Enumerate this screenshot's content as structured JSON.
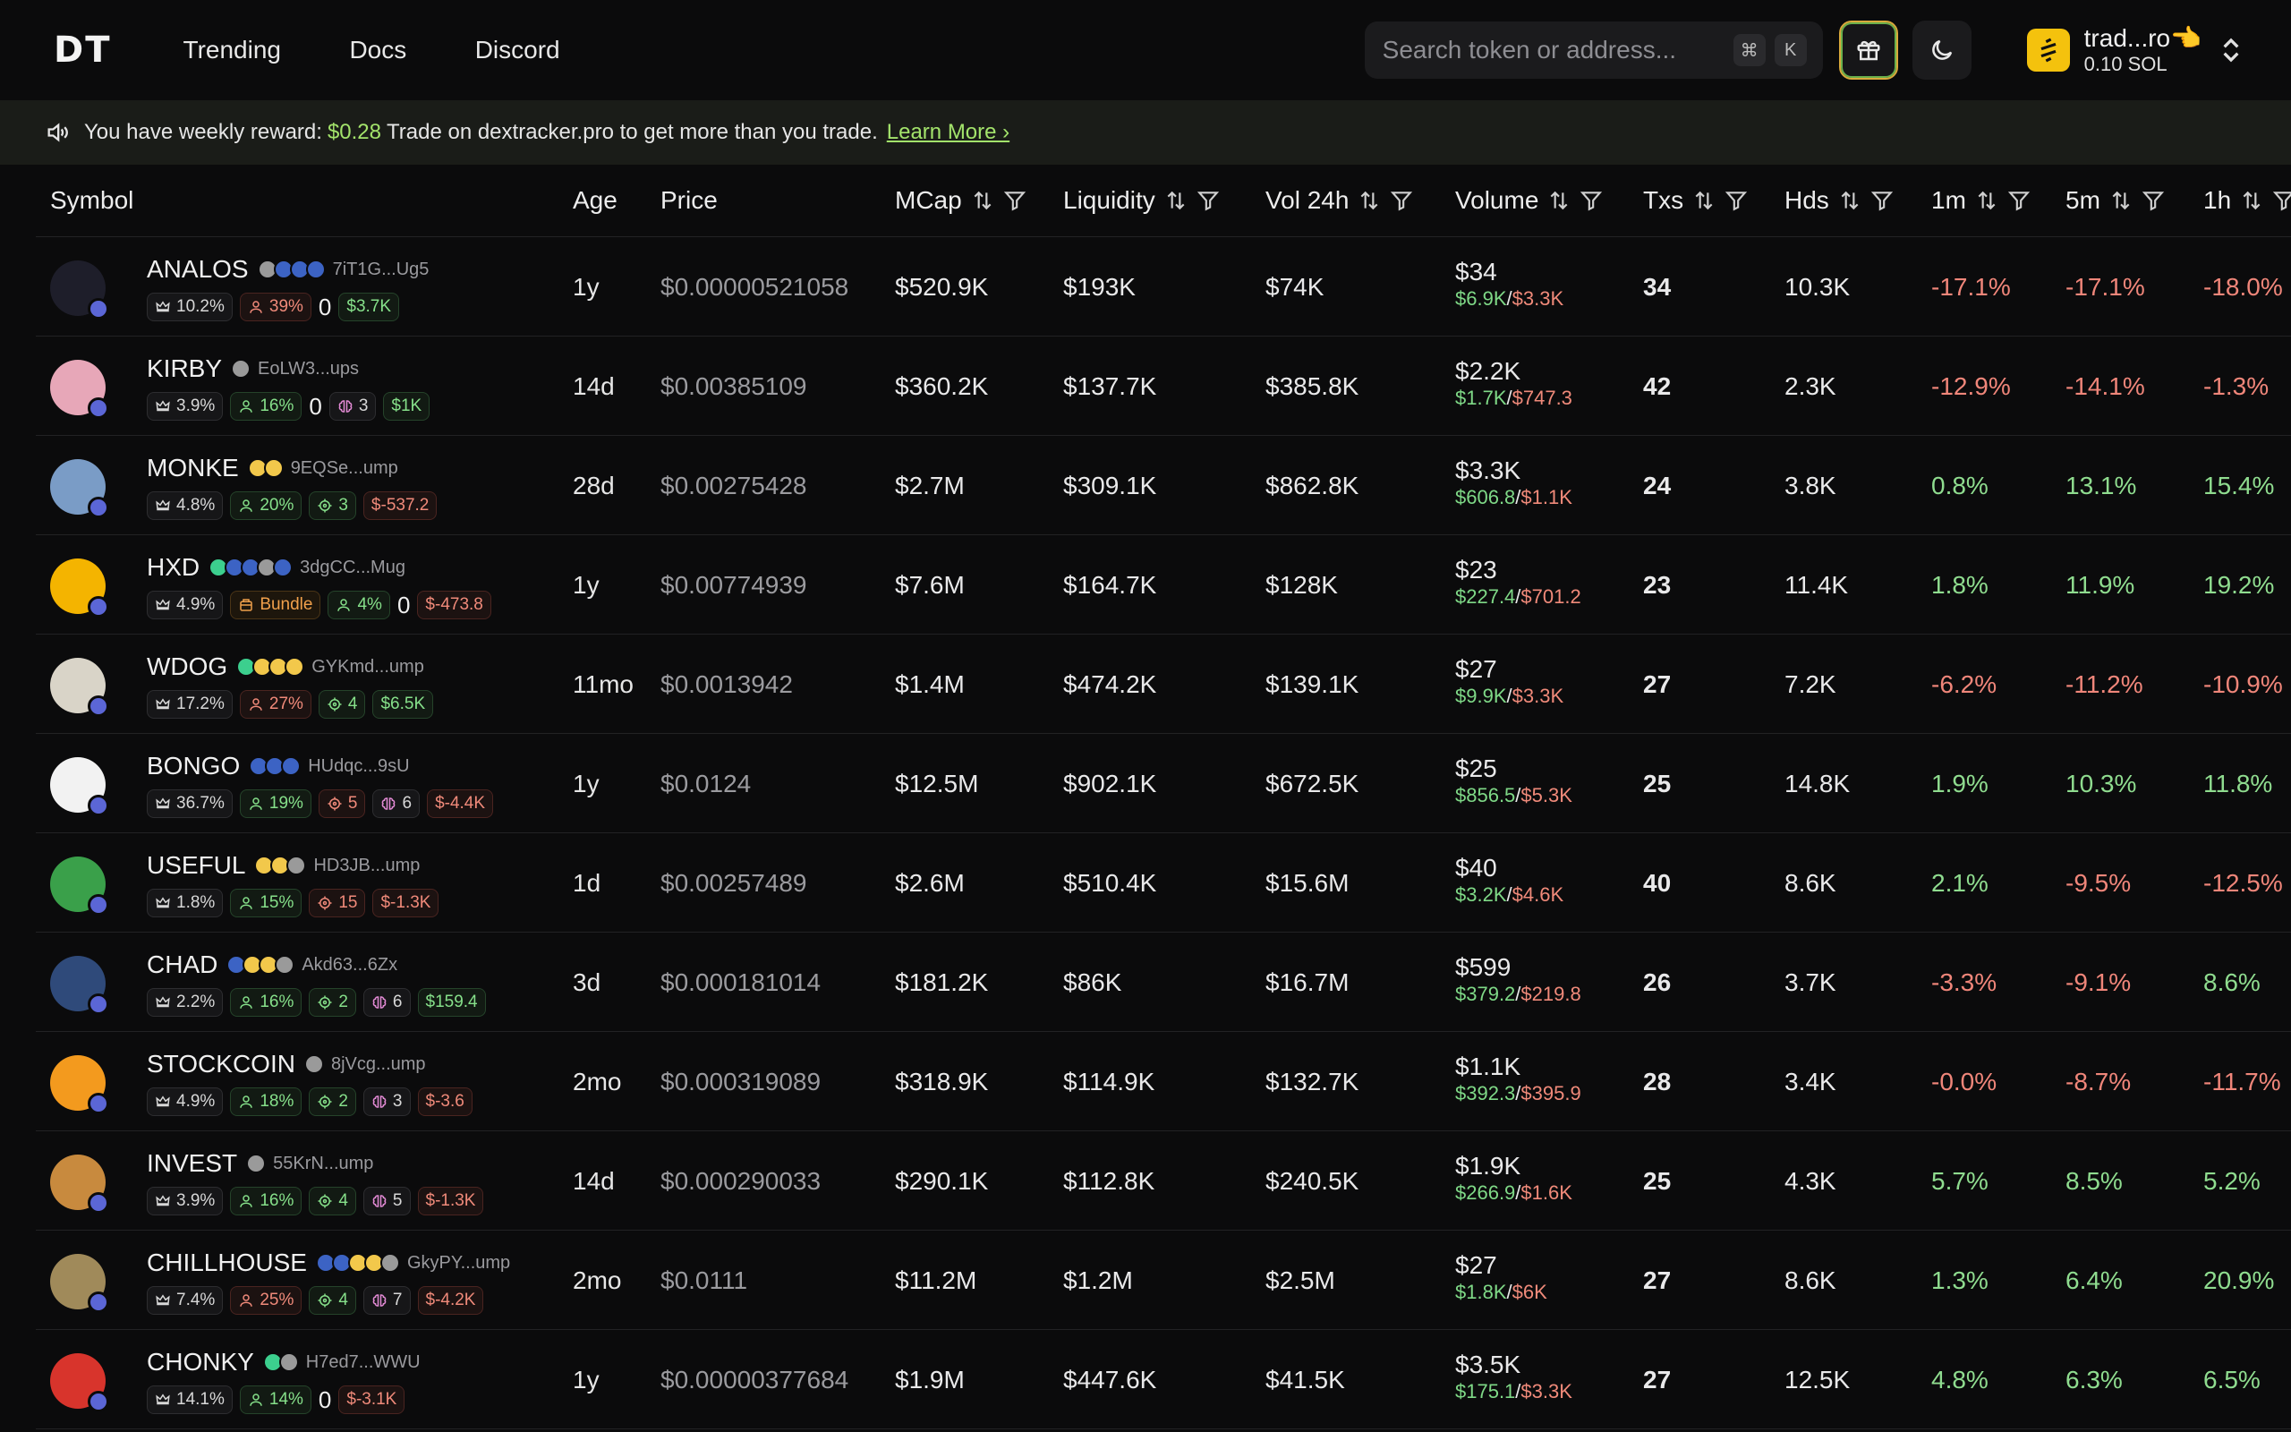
{
  "header": {
    "logo": "DT",
    "nav": [
      "Trending",
      "Docs",
      "Discord"
    ],
    "search_placeholder": "Search token or address...",
    "kbd": [
      "⌘",
      "K"
    ],
    "wallet_name": "trad...ro👈",
    "wallet_balance": "0.10 SOL"
  },
  "banner": {
    "prefix": "You have weekly reward:",
    "amount": "$0.28",
    "message": "Trade on dextracker.pro to get more than you trade.",
    "learn_more": "Learn More ›"
  },
  "columns": [
    "Symbol",
    "Age",
    "Price",
    "MCap",
    "Liquidity",
    "Vol 24h",
    "Volume",
    "Txs",
    "Hds",
    "1m",
    "5m",
    "1h"
  ],
  "rows": [
    {
      "symbol": "ANALOS",
      "addr": "7iT1G...Ug5",
      "avatar_color": "#1e1e2a",
      "socials": [
        "#9a9a9a",
        "#3c63c4",
        "#3c63c4",
        "#3c63c4"
      ],
      "badges": [
        {
          "icon": "crown-icon",
          "text": "10.2%",
          "style": "plain"
        },
        {
          "icon": "user-icon",
          "text": "39%",
          "style": "red"
        },
        {
          "type": "zero",
          "text": "0"
        },
        {
          "text": "$3.7K",
          "style": "green"
        }
      ],
      "age": "1y",
      "price": "$0.00000521058",
      "mcap": "$520.9K",
      "liquidity": "$193K",
      "vol24h": "$74K",
      "volume": "$34",
      "buy": "$6.9K",
      "sell": "$3.3K",
      "txs": "34",
      "hds": "10.3K",
      "m1": "-17.1%",
      "m5": "-17.1%",
      "h1": "-18.0%"
    },
    {
      "symbol": "KIRBY",
      "addr": "EoLW3...ups",
      "avatar_color": "#e7a7b8",
      "socials": [
        "#9a9a9a"
      ],
      "badges": [
        {
          "icon": "crown-icon",
          "text": "3.9%",
          "style": "plain"
        },
        {
          "icon": "user-icon",
          "text": "16%",
          "style": "green"
        },
        {
          "type": "zero",
          "text": "0"
        },
        {
          "icon": "brain-icon",
          "text": "3",
          "style": "plain"
        },
        {
          "text": "$1K",
          "style": "green"
        }
      ],
      "age": "14d",
      "price": "$0.00385109",
      "mcap": "$360.2K",
      "liquidity": "$137.7K",
      "vol24h": "$385.8K",
      "volume": "$2.2K",
      "buy": "$1.7K",
      "sell": "$747.3",
      "txs": "42",
      "hds": "2.3K",
      "m1": "-12.9%",
      "m5": "-14.1%",
      "h1": "-1.3%"
    },
    {
      "symbol": "MONKE",
      "addr": "9EQSe...ump",
      "avatar_color": "#7a9cc6",
      "socials": [
        "#f2c84b",
        "#f2c84b"
      ],
      "badges": [
        {
          "icon": "crown-icon",
          "text": "4.8%",
          "style": "plain"
        },
        {
          "icon": "user-icon",
          "text": "20%",
          "style": "green"
        },
        {
          "icon": "target-icon",
          "text": "3",
          "style": "green"
        },
        {
          "text": "$-537.2",
          "style": "red"
        }
      ],
      "age": "28d",
      "price": "$0.00275428",
      "mcap": "$2.7M",
      "liquidity": "$309.1K",
      "vol24h": "$862.8K",
      "volume": "$3.3K",
      "buy": "$606.8",
      "sell": "$1.1K",
      "txs": "24",
      "hds": "3.8K",
      "m1": "0.8%",
      "m5": "13.1%",
      "h1": "15.4%"
    },
    {
      "symbol": "HXD",
      "addr": "3dgCC...Mug",
      "avatar_color": "#f4b400",
      "socials": [
        "#3ccf8e",
        "#3c63c4",
        "#3c63c4",
        "#9a9a9a",
        "#3c63c4"
      ],
      "badges": [
        {
          "icon": "crown-icon",
          "text": "4.9%",
          "style": "plain"
        },
        {
          "icon": "box-icon",
          "text": "Bundle",
          "style": "orange"
        },
        {
          "icon": "user-icon",
          "text": "4%",
          "style": "green"
        },
        {
          "type": "zero",
          "text": "0"
        },
        {
          "text": "$-473.8",
          "style": "red"
        }
      ],
      "age": "1y",
      "price": "$0.00774939",
      "mcap": "$7.6M",
      "liquidity": "$164.7K",
      "vol24h": "$128K",
      "volume": "$23",
      "buy": "$227.4",
      "sell": "$701.2",
      "txs": "23",
      "hds": "11.4K",
      "m1": "1.8%",
      "m5": "11.9%",
      "h1": "19.2%"
    },
    {
      "symbol": "WDOG",
      "addr": "GYKmd...ump",
      "avatar_color": "#d9d4c8",
      "socials": [
        "#3ccf8e",
        "#f2c84b",
        "#f2c84b",
        "#f2c84b"
      ],
      "badges": [
        {
          "icon": "crown-icon",
          "text": "17.2%",
          "style": "plain"
        },
        {
          "icon": "user-icon",
          "text": "27%",
          "style": "red"
        },
        {
          "icon": "target-icon",
          "text": "4",
          "style": "green"
        },
        {
          "text": "$6.5K",
          "style": "green"
        }
      ],
      "age": "11mo",
      "price": "$0.0013942",
      "mcap": "$1.4M",
      "liquidity": "$474.2K",
      "vol24h": "$139.1K",
      "volume": "$27",
      "buy": "$9.9K",
      "sell": "$3.3K",
      "txs": "27",
      "hds": "7.2K",
      "m1": "-6.2%",
      "m5": "-11.2%",
      "h1": "-10.9%"
    },
    {
      "symbol": "BONGO",
      "addr": "HUdqc...9sU",
      "avatar_color": "#f2f2f2",
      "socials": [
        "#3c63c4",
        "#3c63c4",
        "#3c63c4"
      ],
      "badges": [
        {
          "icon": "crown-icon",
          "text": "36.7%",
          "style": "plain"
        },
        {
          "icon": "user-icon",
          "text": "19%",
          "style": "green"
        },
        {
          "icon": "target-icon",
          "text": "5",
          "style": "red"
        },
        {
          "icon": "brain-icon",
          "text": "6",
          "style": "plain"
        },
        {
          "text": "$-4.4K",
          "style": "red"
        }
      ],
      "age": "1y",
      "price": "$0.0124",
      "mcap": "$12.5M",
      "liquidity": "$902.1K",
      "vol24h": "$672.5K",
      "volume": "$25",
      "buy": "$856.5",
      "sell": "$5.3K",
      "txs": "25",
      "hds": "14.8K",
      "m1": "1.9%",
      "m5": "10.3%",
      "h1": "11.8%"
    },
    {
      "symbol": "USEFUL",
      "addr": "HD3JB...ump",
      "avatar_color": "#3aa04a",
      "socials": [
        "#f2c84b",
        "#f2c84b",
        "#9a9a9a"
      ],
      "badges": [
        {
          "icon": "crown-icon",
          "text": "1.8%",
          "style": "plain"
        },
        {
          "icon": "user-icon",
          "text": "15%",
          "style": "green"
        },
        {
          "icon": "target-icon",
          "text": "15",
          "style": "red"
        },
        {
          "text": "$-1.3K",
          "style": "red"
        }
      ],
      "age": "1d",
      "price": "$0.00257489",
      "mcap": "$2.6M",
      "liquidity": "$510.4K",
      "vol24h": "$15.6M",
      "volume": "$40",
      "buy": "$3.2K",
      "sell": "$4.6K",
      "txs": "40",
      "hds": "8.6K",
      "m1": "2.1%",
      "m5": "-9.5%",
      "h1": "-12.5%"
    },
    {
      "symbol": "CHAD",
      "addr": "Akd63...6Zx",
      "avatar_color": "#2f4a7a",
      "socials": [
        "#3c63c4",
        "#f2c84b",
        "#f2c84b",
        "#9a9a9a"
      ],
      "badges": [
        {
          "icon": "crown-icon",
          "text": "2.2%",
          "style": "plain"
        },
        {
          "icon": "user-icon",
          "text": "16%",
          "style": "green"
        },
        {
          "icon": "target-icon",
          "text": "2",
          "style": "green"
        },
        {
          "icon": "brain-icon",
          "text": "6",
          "style": "plain"
        },
        {
          "text": "$159.4",
          "style": "green"
        }
      ],
      "age": "3d",
      "price": "$0.000181014",
      "mcap": "$181.2K",
      "liquidity": "$86K",
      "vol24h": "$16.7M",
      "volume": "$599",
      "buy": "$379.2",
      "sell": "$219.8",
      "txs": "26",
      "hds": "3.7K",
      "m1": "-3.3%",
      "m5": "-9.1%",
      "h1": "8.6%"
    },
    {
      "symbol": "STOCKCOIN",
      "addr": "8jVcg...ump",
      "avatar_color": "#f39a1e",
      "socials": [
        "#9a9a9a"
      ],
      "badges": [
        {
          "icon": "crown-icon",
          "text": "4.9%",
          "style": "plain"
        },
        {
          "icon": "user-icon",
          "text": "18%",
          "style": "green"
        },
        {
          "icon": "target-icon",
          "text": "2",
          "style": "green"
        },
        {
          "icon": "brain-icon",
          "text": "3",
          "style": "plain"
        },
        {
          "text": "$-3.6",
          "style": "red"
        }
      ],
      "age": "2mo",
      "price": "$0.000319089",
      "mcap": "$318.9K",
      "liquidity": "$114.9K",
      "vol24h": "$132.7K",
      "volume": "$1.1K",
      "buy": "$392.3",
      "sell": "$395.9",
      "txs": "28",
      "hds": "3.4K",
      "m1": "-0.0%",
      "m5": "-8.7%",
      "h1": "-11.7%"
    },
    {
      "symbol": "INVEST",
      "addr": "55KrN...ump",
      "avatar_color": "#c88a3e",
      "socials": [
        "#9a9a9a"
      ],
      "badges": [
        {
          "icon": "crown-icon",
          "text": "3.9%",
          "style": "plain"
        },
        {
          "icon": "user-icon",
          "text": "16%",
          "style": "green"
        },
        {
          "icon": "target-icon",
          "text": "4",
          "style": "green"
        },
        {
          "icon": "brain-icon",
          "text": "5",
          "style": "plain"
        },
        {
          "text": "$-1.3K",
          "style": "red"
        }
      ],
      "age": "14d",
      "price": "$0.000290033",
      "mcap": "$290.1K",
      "liquidity": "$112.8K",
      "vol24h": "$240.5K",
      "volume": "$1.9K",
      "buy": "$266.9",
      "sell": "$1.6K",
      "txs": "25",
      "hds": "4.3K",
      "m1": "5.7%",
      "m5": "8.5%",
      "h1": "5.2%"
    },
    {
      "symbol": "CHILLHOUSE",
      "addr": "GkyPY...ump",
      "avatar_color": "#a08a5a",
      "socials": [
        "#3c63c4",
        "#3c63c4",
        "#f2c84b",
        "#f2c84b",
        "#9a9a9a"
      ],
      "badges": [
        {
          "icon": "crown-icon",
          "text": "7.4%",
          "style": "plain"
        },
        {
          "icon": "user-icon",
          "text": "25%",
          "style": "red"
        },
        {
          "icon": "target-icon",
          "text": "4",
          "style": "green"
        },
        {
          "icon": "brain-icon",
          "text": "7",
          "style": "plain"
        },
        {
          "text": "$-4.2K",
          "style": "red"
        }
      ],
      "age": "2mo",
      "price": "$0.0111",
      "mcap": "$11.2M",
      "liquidity": "$1.2M",
      "vol24h": "$2.5M",
      "volume": "$27",
      "buy": "$1.8K",
      "sell": "$6K",
      "txs": "27",
      "hds": "8.6K",
      "m1": "1.3%",
      "m5": "6.4%",
      "h1": "20.9%"
    },
    {
      "symbol": "CHONKY",
      "addr": "H7ed7...WWU",
      "avatar_color": "#d8342c",
      "socials": [
        "#3ccf8e",
        "#9a9a9a"
      ],
      "badges": [
        {
          "icon": "crown-icon",
          "text": "14.1%",
          "style": "plain"
        },
        {
          "icon": "user-icon",
          "text": "14%",
          "style": "green"
        },
        {
          "type": "zero",
          "text": "0"
        },
        {
          "text": "$-3.1K",
          "style": "red"
        }
      ],
      "age": "1y",
      "price": "$0.00000377684",
      "mcap": "$1.9M",
      "liquidity": "$447.6K",
      "vol24h": "$41.5K",
      "volume": "$3.5K",
      "buy": "$175.1",
      "sell": "$3.3K",
      "txs": "27",
      "hds": "12.5K",
      "m1": "4.8%",
      "m5": "6.3%",
      "h1": "6.5%"
    }
  ]
}
